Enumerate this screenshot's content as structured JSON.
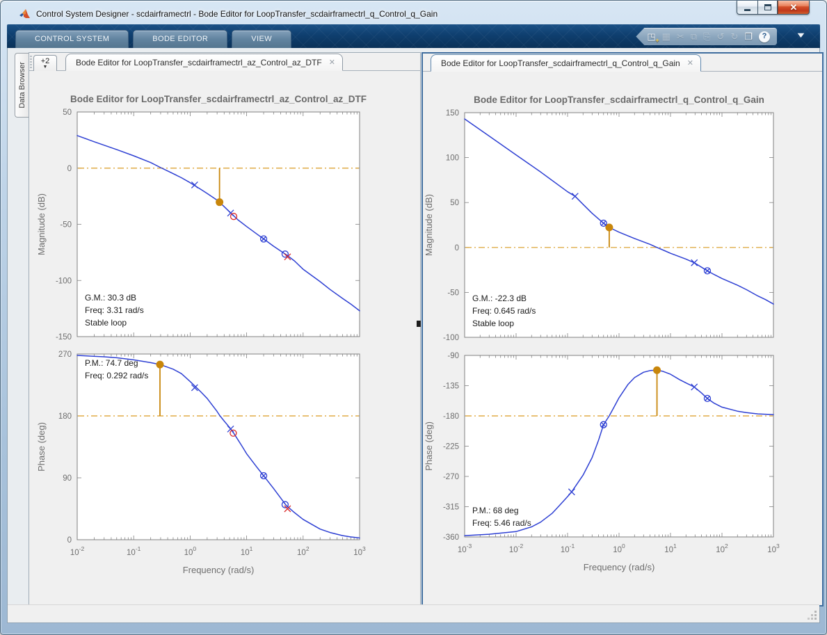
{
  "window": {
    "title": "Control System Designer - scdairframectrl - Bode Editor for LoopTransfer_scdairframectrl_q_Control_q_Gain",
    "close_glyph": "✕"
  },
  "ribbon": {
    "tabs": [
      {
        "label": "CONTROL SYSTEM"
      },
      {
        "label": "BODE EDITOR"
      },
      {
        "label": "VIEW"
      }
    ],
    "toolbar_icons": [
      {
        "name": "new-document-icon",
        "glyph": "◳",
        "badge": "+",
        "enabled": true
      },
      {
        "name": "save-icon",
        "glyph": "▦",
        "badge": "",
        "enabled": false
      },
      {
        "name": "cut-icon",
        "glyph": "✂",
        "badge": "",
        "enabled": false
      },
      {
        "name": "copy-icon",
        "glyph": "⧉",
        "badge": "",
        "enabled": false
      },
      {
        "name": "paste-icon",
        "glyph": "⎘",
        "badge": "",
        "enabled": false
      },
      {
        "name": "undo-icon",
        "glyph": "↺",
        "badge": "",
        "enabled": false
      },
      {
        "name": "redo-icon",
        "glyph": "↻",
        "badge": "",
        "enabled": false
      },
      {
        "name": "window-layout-icon",
        "glyph": "❐",
        "badge": "",
        "enabled": true
      },
      {
        "name": "help-icon",
        "glyph": "?",
        "badge": "",
        "enabled": true
      }
    ],
    "collapse_glyph": "▼"
  },
  "data_browser": {
    "label": "Data Browser"
  },
  "doc_tabs": {
    "overflow_label": "+2",
    "overflow_arrow": "▼",
    "left": {
      "label": "Bode Editor for LoopTransfer_scdairframectrl_az_Control_az_DTF",
      "close_glyph": "✕",
      "active": false
    },
    "right": {
      "label": "Bode Editor for LoopTransfer_scdairframectrl_q_Control_q_Gain",
      "close_glyph": "✕",
      "active": true
    }
  },
  "colors": {
    "curve": "#2d3fd3",
    "ref_line": "#d99a20",
    "margin_marker": "#c8860b",
    "red_marker": "#db2a2a",
    "axis": "#808080"
  },
  "chart_data": [
    {
      "id": "bode-left",
      "type": "line",
      "title": "Bode Editor for LoopTransfer_scdairframectrl_az_Control_az_DTF",
      "xlabel": "Frequency (rad/s)",
      "xscale": "log",
      "xlim": [
        0.01,
        1000
      ],
      "xtick_exponents": [
        -2,
        -1,
        0,
        1,
        2,
        3
      ],
      "subplots": [
        {
          "name": "magnitude",
          "ylabel": "Magnitude (dB)",
          "ylim": [
            -150,
            50
          ],
          "yticks": [
            50,
            0,
            -50,
            -100,
            -150
          ],
          "ref_line": 0,
          "curve": [
            [
              0.01,
              29
            ],
            [
              0.02,
              23.5
            ],
            [
              0.05,
              16.5
            ],
            [
              0.1,
              11
            ],
            [
              0.2,
              5
            ],
            [
              0.292,
              0.8
            ],
            [
              0.4,
              -2.5
            ],
            [
              0.7,
              -8.5
            ],
            [
              1,
              -13
            ],
            [
              1.5,
              -18.5
            ],
            [
              2,
              -22.5
            ],
            [
              3,
              -28.5
            ],
            [
              3.31,
              -30.3
            ],
            [
              5,
              -39
            ],
            [
              7,
              -46
            ],
            [
              10,
              -52
            ],
            [
              15,
              -58.5
            ],
            [
              20,
              -63
            ],
            [
              30,
              -69.5
            ],
            [
              50,
              -77
            ],
            [
              70,
              -82.5
            ],
            [
              100,
              -90
            ],
            [
              200,
              -101
            ],
            [
              300,
              -108
            ],
            [
              500,
              -116
            ],
            [
              700,
              -121
            ],
            [
              1000,
              -127
            ]
          ],
          "margin_marker": {
            "freq": 3.31,
            "value": -30.3,
            "stem_from": 0
          },
          "markers": [
            {
              "type": "x",
              "color": "blue",
              "freq": 1.2,
              "value": -15
            },
            {
              "type": "x",
              "color": "blue",
              "freq": 5.2,
              "value": -40
            },
            {
              "type": "o",
              "color": "red",
              "freq": 5.9,
              "value": -43
            },
            {
              "type": "ox",
              "color": "blue",
              "freq": 20,
              "value": -63
            },
            {
              "type": "o",
              "color": "blue",
              "freq": 48,
              "value": -76.5
            },
            {
              "type": "x",
              "color": "red",
              "freq": 53,
              "value": -79
            }
          ],
          "annotation": {
            "lines": [
              "G.M.: 30.3 dB",
              "Freq: 3.31 rad/s",
              "Stable loop"
            ],
            "position": "bottom-left"
          }
        },
        {
          "name": "phase",
          "ylabel": "Phase (deg)",
          "ylim": [
            0,
            270
          ],
          "yticks": [
            270,
            180,
            90,
            0
          ],
          "ref_line": 180,
          "curve": [
            [
              0.01,
              268
            ],
            [
              0.03,
              266
            ],
            [
              0.05,
              264.5
            ],
            [
              0.1,
              261.5
            ],
            [
              0.2,
              257.5
            ],
            [
              0.292,
              254.7
            ],
            [
              0.5,
              248
            ],
            [
              0.7,
              241.5
            ],
            [
              1,
              230
            ],
            [
              1.5,
              216
            ],
            [
              2,
              205.5
            ],
            [
              3,
              186.5
            ],
            [
              3.31,
              181
            ],
            [
              4,
              172.5
            ],
            [
              5,
              163
            ],
            [
              6,
              154
            ],
            [
              8,
              138
            ],
            [
              10,
              125
            ],
            [
              15,
              106
            ],
            [
              20,
              93
            ],
            [
              30,
              74.5
            ],
            [
              50,
              50
            ],
            [
              70,
              39.5
            ],
            [
              100,
              29.5
            ],
            [
              200,
              15.5
            ],
            [
              300,
              10.5
            ],
            [
              500,
              6
            ],
            [
              700,
              4
            ],
            [
              1000,
              2.5
            ]
          ],
          "margin_marker": {
            "freq": 0.292,
            "value": 254.7,
            "stem_from": 180
          },
          "markers": [
            {
              "type": "x",
              "color": "blue",
              "freq": 1.2,
              "value": 221
            },
            {
              "type": "x",
              "color": "blue",
              "freq": 5.2,
              "value": 161
            },
            {
              "type": "o",
              "color": "red",
              "freq": 5.8,
              "value": 155
            },
            {
              "type": "ox",
              "color": "blue",
              "freq": 20,
              "value": 93
            },
            {
              "type": "o",
              "color": "blue",
              "freq": 48,
              "value": 51
            },
            {
              "type": "x",
              "color": "red",
              "freq": 53,
              "value": 45
            }
          ],
          "annotation": {
            "lines": [
              "P.M.: 74.7 deg",
              "Freq: 0.292 rad/s"
            ],
            "position": "top-left"
          }
        }
      ]
    },
    {
      "id": "bode-right",
      "type": "line",
      "title": "Bode Editor for LoopTransfer_scdairframectrl_q_Control_q_Gain",
      "xlabel": "Frequency (rad/s)",
      "xscale": "log",
      "xlim": [
        0.001,
        1000
      ],
      "xtick_exponents": [
        -3,
        -2,
        -1,
        0,
        1,
        2,
        3
      ],
      "subplots": [
        {
          "name": "magnitude",
          "ylabel": "Magnitude (dB)",
          "ylim": [
            -100,
            150
          ],
          "yticks": [
            150,
            100,
            50,
            0,
            -50,
            -100
          ],
          "ref_line": 0,
          "curve": [
            [
              0.001,
              143
            ],
            [
              0.003,
              124
            ],
            [
              0.01,
              103
            ],
            [
              0.03,
              84
            ],
            [
              0.1,
              62
            ],
            [
              0.14,
              57
            ],
            [
              0.2,
              48
            ],
            [
              0.3,
              38
            ],
            [
              0.5,
              27
            ],
            [
              0.645,
              22.3
            ],
            [
              1,
              17
            ],
            [
              2,
              10
            ],
            [
              4,
              3.5
            ],
            [
              5.46,
              0
            ],
            [
              8,
              -4
            ],
            [
              10,
              -6.5
            ],
            [
              20,
              -13
            ],
            [
              29,
              -17
            ],
            [
              40,
              -22
            ],
            [
              52,
              -26
            ],
            [
              70,
              -30
            ],
            [
              100,
              -34.5
            ],
            [
              200,
              -42
            ],
            [
              300,
              -47
            ],
            [
              500,
              -54
            ],
            [
              700,
              -58
            ],
            [
              1000,
              -63
            ]
          ],
          "margin_marker": {
            "freq": 0.645,
            "value": 22.3,
            "stem_from": 0
          },
          "markers": [
            {
              "type": "x",
              "color": "blue",
              "freq": 0.14,
              "value": 57
            },
            {
              "type": "ox",
              "color": "blue",
              "freq": 0.5,
              "value": 27
            },
            {
              "type": "x",
              "color": "blue",
              "freq": 29,
              "value": -17
            },
            {
              "type": "ox",
              "color": "blue",
              "freq": 52,
              "value": -26
            }
          ],
          "annotation": {
            "lines": [
              "G.M.: -22.3 dB",
              "Freq: 0.645 rad/s",
              "Stable loop"
            ],
            "position": "bottom-left"
          }
        },
        {
          "name": "phase",
          "ylabel": "Phase (deg)",
          "ylim": [
            -360,
            -90
          ],
          "yticks": [
            -90,
            -135,
            -180,
            -225,
            -270,
            -315,
            -360
          ],
          "ref_line": -180,
          "curve": [
            [
              0.001,
              -358
            ],
            [
              0.003,
              -356
            ],
            [
              0.01,
              -352
            ],
            [
              0.02,
              -345
            ],
            [
              0.03,
              -338
            ],
            [
              0.05,
              -325
            ],
            [
              0.07,
              -313
            ],
            [
              0.1,
              -300
            ],
            [
              0.12,
              -293
            ],
            [
              0.2,
              -268
            ],
            [
              0.3,
              -242
            ],
            [
              0.4,
              -216
            ],
            [
              0.5,
              -193
            ],
            [
              0.645,
              -180
            ],
            [
              0.8,
              -167
            ],
            [
              1,
              -153
            ],
            [
              1.5,
              -133
            ],
            [
              2,
              -123
            ],
            [
              3,
              -115
            ],
            [
              4,
              -112.5
            ],
            [
              5.46,
              -112
            ],
            [
              7,
              -113.5
            ],
            [
              10,
              -118
            ],
            [
              15,
              -126
            ],
            [
              20,
              -131
            ],
            [
              29,
              -137
            ],
            [
              40,
              -146
            ],
            [
              52,
              -154
            ],
            [
              70,
              -161
            ],
            [
              100,
              -167
            ],
            [
              200,
              -173
            ],
            [
              300,
              -175
            ],
            [
              500,
              -177
            ],
            [
              1000,
              -178
            ]
          ],
          "margin_marker": {
            "freq": 5.46,
            "value": -112,
            "stem_from": -180
          },
          "markers": [
            {
              "type": "x",
              "color": "blue",
              "freq": 0.12,
              "value": -293
            },
            {
              "type": "ox",
              "color": "blue",
              "freq": 0.5,
              "value": -193
            },
            {
              "type": "x",
              "color": "blue",
              "freq": 29,
              "value": -137
            },
            {
              "type": "ox",
              "color": "blue",
              "freq": 52,
              "value": -154
            }
          ],
          "annotation": {
            "lines": [
              "P.M.: 68 deg",
              "Freq: 5.46 rad/s"
            ],
            "position": "bottom-left"
          }
        }
      ]
    }
  ]
}
